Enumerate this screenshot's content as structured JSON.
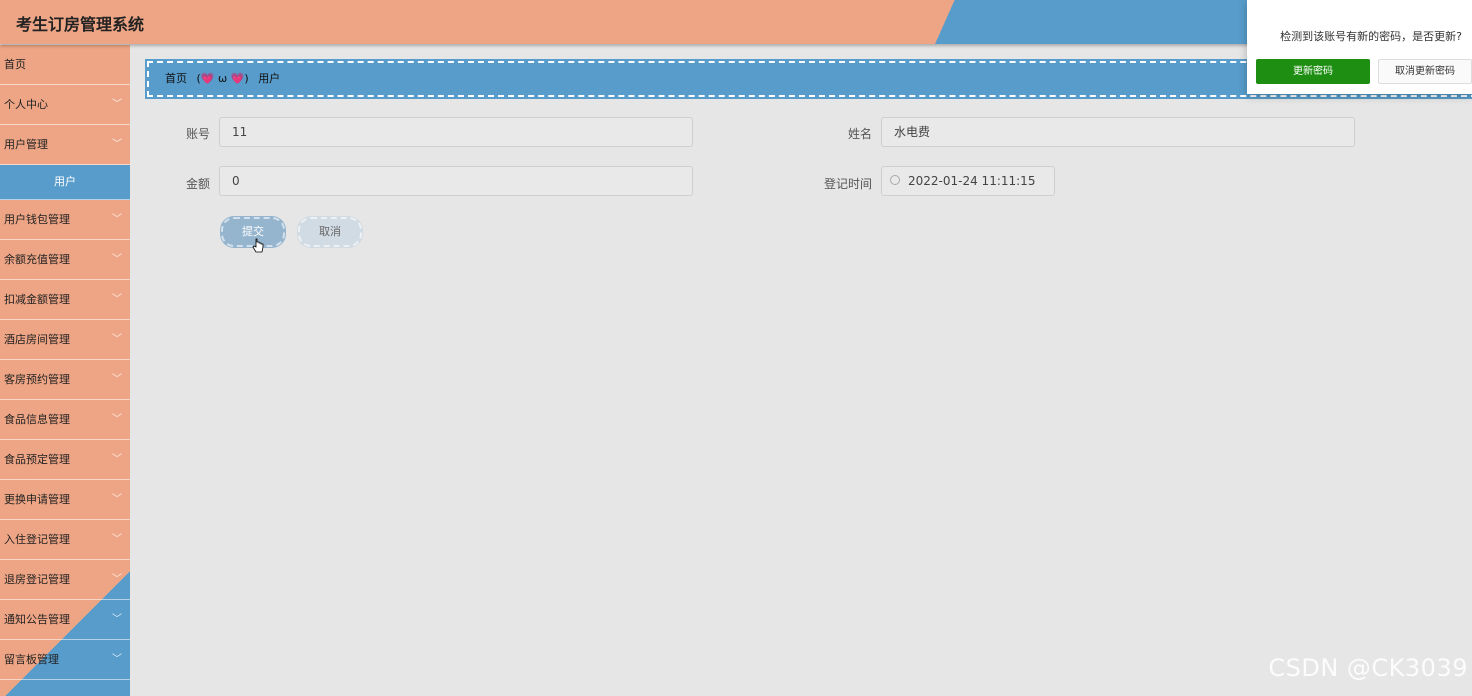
{
  "header": {
    "title": "考生订房管理系统"
  },
  "sidebar": {
    "items": [
      {
        "label": "首页",
        "has_chevron": false
      },
      {
        "label": "个人中心",
        "has_chevron": true
      },
      {
        "label": "用户管理",
        "has_chevron": true
      },
      {
        "label": "用户钱包管理",
        "has_chevron": true
      },
      {
        "label": "余额充值管理",
        "has_chevron": true
      },
      {
        "label": "扣减金额管理",
        "has_chevron": true
      },
      {
        "label": "酒店房间管理",
        "has_chevron": true
      },
      {
        "label": "客房预约管理",
        "has_chevron": true
      },
      {
        "label": "食品信息管理",
        "has_chevron": true
      },
      {
        "label": "食品预定管理",
        "has_chevron": true
      },
      {
        "label": "更换申请管理",
        "has_chevron": true
      },
      {
        "label": "入住登记管理",
        "has_chevron": true
      },
      {
        "label": "退房登记管理",
        "has_chevron": true
      },
      {
        "label": "通知公告管理",
        "has_chevron": true
      },
      {
        "label": "留言板管理",
        "has_chevron": true
      }
    ],
    "active_sub_item": "用户",
    "chevron_glyph": "﹀"
  },
  "breadcrumb": {
    "home": "首页",
    "separator": "(💗 ω 💗)",
    "current": "用户"
  },
  "form": {
    "account_label": "账号",
    "account_value": "11",
    "name_label": "姓名",
    "name_value": "水电费",
    "amount_label": "金额",
    "amount_value": "0",
    "time_label": "登记时间",
    "time_value": "2022-01-24 11:11:15",
    "submit_label": "提交",
    "cancel_label": "取消"
  },
  "popup": {
    "message": "检测到该账号有新的密码，是否更新?",
    "update_label": "更新密码",
    "cancel_label": "取消更新密码"
  },
  "watermark": "CSDN @CK3039",
  "colors": {
    "peach": "#eea585",
    "blue": "#579ccb",
    "green": "#1e8e12",
    "background": "#e6e6e6"
  }
}
